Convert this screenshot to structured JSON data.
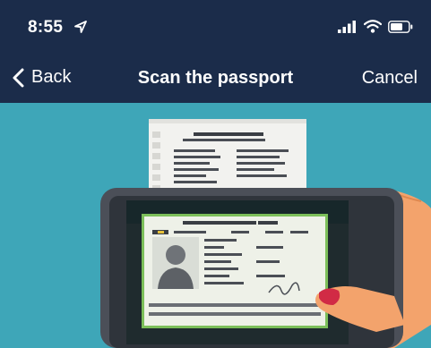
{
  "status_bar": {
    "time": "8:55",
    "icons": [
      "location-arrow-icon",
      "signal-bars-icon",
      "wifi-icon",
      "battery-icon"
    ]
  },
  "nav": {
    "back_label": "Back",
    "title": "Scan the passport",
    "cancel_label": "Cancel"
  },
  "illustration": {
    "description_icon": "passport-scan-illustration",
    "colors": {
      "background": "#3ea6b8",
      "phone": "#4b4f58",
      "screen_dark": "#1f2b2e",
      "document": "#eef1e8",
      "document_border": "#7cbf5a",
      "hand": "#f3a36c",
      "nail": "#d12b45"
    }
  },
  "colors": {
    "nav_background": "#1b2c4a",
    "nav_text": "#ffffff"
  }
}
